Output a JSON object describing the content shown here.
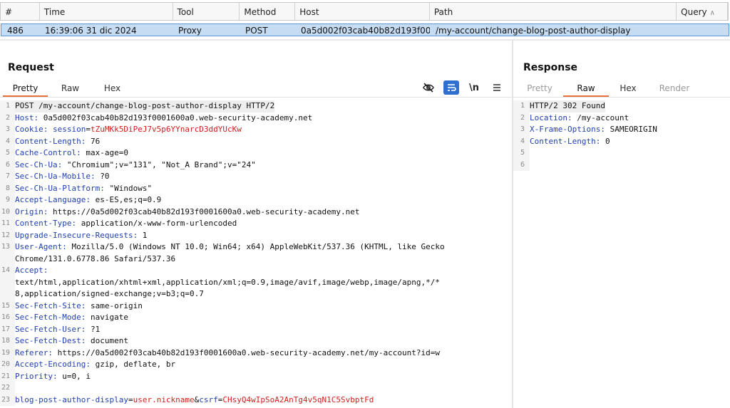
{
  "history": {
    "columns": [
      {
        "label": "#",
        "width": 55
      },
      {
        "label": "Time",
        "width": 187
      },
      {
        "label": "Tool",
        "width": 94
      },
      {
        "label": "Method",
        "width": 78
      },
      {
        "label": "Host",
        "width": 189
      },
      {
        "label": "Path",
        "width": 347
      },
      {
        "label": "Query",
        "width": 72
      }
    ],
    "row": {
      "id": "486",
      "time": "16:39:06 31 dic 2024",
      "tool": "Proxy",
      "method": "POST",
      "host": "0a5d002f03cab40b82d193f00...",
      "path": "/my-account/change-blog-post-author-display",
      "query": ""
    }
  },
  "request": {
    "title": "Request",
    "tabs": [
      "Pretty",
      "Raw",
      "Hex"
    ],
    "active_tab": "Pretty",
    "toolbar": [
      "eye-off-icon",
      "wrap-icon",
      "newline-icon",
      "menu-icon"
    ],
    "lines": [
      {
        "n": "1",
        "parts": [
          {
            "t": "POST /my-account/change-blog-post-author-display HTTP/2",
            "c": ""
          }
        ]
      },
      {
        "n": "2",
        "parts": [
          {
            "t": "Host:",
            "c": "k"
          },
          {
            "t": " 0a5d002f03cab40b82d193f0001600a0.web-security-academy.net",
            "c": ""
          }
        ]
      },
      {
        "n": "3",
        "parts": [
          {
            "t": "Cookie:",
            "c": "k"
          },
          {
            "t": " ",
            "c": ""
          },
          {
            "t": "session",
            "c": "k"
          },
          {
            "t": "=",
            "c": ""
          },
          {
            "t": "tZuMKk5DiPeJ7v5p6YYnarcD3ddYUcKw",
            "c": "red"
          }
        ]
      },
      {
        "n": "4",
        "parts": [
          {
            "t": "Content-Length:",
            "c": "k"
          },
          {
            "t": " 76",
            "c": ""
          }
        ]
      },
      {
        "n": "5",
        "parts": [
          {
            "t": "Cache-Control:",
            "c": "k"
          },
          {
            "t": " max-age=0",
            "c": ""
          }
        ]
      },
      {
        "n": "6",
        "parts": [
          {
            "t": "Sec-Ch-Ua:",
            "c": "k"
          },
          {
            "t": " \"Chromium\";v=\"131\", \"Not_A Brand\";v=\"24\"",
            "c": ""
          }
        ]
      },
      {
        "n": "7",
        "parts": [
          {
            "t": "Sec-Ch-Ua-Mobile:",
            "c": "k"
          },
          {
            "t": " ?0",
            "c": ""
          }
        ]
      },
      {
        "n": "8",
        "parts": [
          {
            "t": "Sec-Ch-Ua-Platform:",
            "c": "k"
          },
          {
            "t": " \"Windows\"",
            "c": ""
          }
        ]
      },
      {
        "n": "9",
        "parts": [
          {
            "t": "Accept-Language:",
            "c": "k"
          },
          {
            "t": " es-ES,es;q=0.9",
            "c": ""
          }
        ]
      },
      {
        "n": "10",
        "parts": [
          {
            "t": "Origin:",
            "c": "k"
          },
          {
            "t": " https://0a5d002f03cab40b82d193f0001600a0.web-security-academy.net",
            "c": ""
          }
        ]
      },
      {
        "n": "11",
        "parts": [
          {
            "t": "Content-Type:",
            "c": "k"
          },
          {
            "t": " application/x-www-form-urlencoded",
            "c": ""
          }
        ]
      },
      {
        "n": "12",
        "parts": [
          {
            "t": "Upgrade-Insecure-Requests:",
            "c": "k"
          },
          {
            "t": " 1",
            "c": ""
          }
        ]
      },
      {
        "n": "13",
        "parts": [
          {
            "t": "User-Agent:",
            "c": "k"
          },
          {
            "t": " Mozilla/5.0 (Windows NT 10.0; Win64; x64) AppleWebKit/537.36 (KHTML, like Gecko",
            "c": ""
          }
        ]
      },
      {
        "n": "",
        "parts": [
          {
            "t": "Chrome/131.0.6778.86 Safari/537.36",
            "c": ""
          }
        ]
      },
      {
        "n": "14",
        "parts": [
          {
            "t": "Accept:",
            "c": "k"
          }
        ]
      },
      {
        "n": "",
        "parts": [
          {
            "t": "text/html,application/xhtml+xml,application/xml;q=0.9,image/avif,image/webp,image/apng,*/*",
            "c": ""
          }
        ]
      },
      {
        "n": "",
        "parts": [
          {
            "t": "8,application/signed-exchange;v=b3;q=0.7",
            "c": ""
          }
        ]
      },
      {
        "n": "15",
        "parts": [
          {
            "t": "Sec-Fetch-Site:",
            "c": "k"
          },
          {
            "t": " same-origin",
            "c": ""
          }
        ]
      },
      {
        "n": "16",
        "parts": [
          {
            "t": "Sec-Fetch-Mode:",
            "c": "k"
          },
          {
            "t": " navigate",
            "c": ""
          }
        ]
      },
      {
        "n": "17",
        "parts": [
          {
            "t": "Sec-Fetch-User:",
            "c": "k"
          },
          {
            "t": " ?1",
            "c": ""
          }
        ]
      },
      {
        "n": "18",
        "parts": [
          {
            "t": "Sec-Fetch-Dest:",
            "c": "k"
          },
          {
            "t": " document",
            "c": ""
          }
        ]
      },
      {
        "n": "19",
        "parts": [
          {
            "t": "Referer:",
            "c": "k"
          },
          {
            "t": " https://0a5d002f03cab40b82d193f0001600a0.web-security-academy.net/my-account?id=w",
            "c": ""
          }
        ]
      },
      {
        "n": "20",
        "parts": [
          {
            "t": "Accept-Encoding:",
            "c": "k"
          },
          {
            "t": " gzip, deflate, br",
            "c": ""
          }
        ]
      },
      {
        "n": "21",
        "parts": [
          {
            "t": "Priority:",
            "c": "k"
          },
          {
            "t": " u=0, i",
            "c": ""
          }
        ]
      },
      {
        "n": "22",
        "parts": [
          {
            "t": "",
            "c": ""
          }
        ]
      },
      {
        "n": "23",
        "parts": [
          {
            "t": "blog-post-author-display",
            "c": "k"
          },
          {
            "t": "=",
            "c": ""
          },
          {
            "t": "user.nickname",
            "c": "red"
          },
          {
            "t": "&",
            "c": ""
          },
          {
            "t": "csrf",
            "c": "k"
          },
          {
            "t": "=",
            "c": ""
          },
          {
            "t": "CHsyQ4wIpSoA2AnTg4v5qN1C5SvbptFd",
            "c": "red"
          }
        ]
      }
    ]
  },
  "response": {
    "title": "Response",
    "tabs": [
      "Pretty",
      "Raw",
      "Hex",
      "Render"
    ],
    "active_tab": "Raw",
    "disabled_tabs": [
      "Pretty",
      "Render"
    ],
    "lines": [
      {
        "n": "1",
        "parts": [
          {
            "t": "HTTP/2 302 Found",
            "c": ""
          }
        ]
      },
      {
        "n": "2",
        "parts": [
          {
            "t": "Location:",
            "c": "k"
          },
          {
            "t": " /my-account",
            "c": ""
          }
        ]
      },
      {
        "n": "3",
        "parts": [
          {
            "t": "X-Frame-Options:",
            "c": "k"
          },
          {
            "t": " SAMEORIGIN",
            "c": ""
          }
        ]
      },
      {
        "n": "4",
        "parts": [
          {
            "t": "Content-Length:",
            "c": "k"
          },
          {
            "t": " 0",
            "c": ""
          }
        ]
      },
      {
        "n": "5",
        "parts": [
          {
            "t": "",
            "c": ""
          }
        ]
      },
      {
        "n": "6",
        "parts": [
          {
            "t": "",
            "c": ""
          }
        ]
      }
    ]
  },
  "colors": {
    "accent": "#e8703a",
    "selection": "#c6dcf3",
    "key": "#1f3fb0",
    "value": "#d11d1d"
  }
}
